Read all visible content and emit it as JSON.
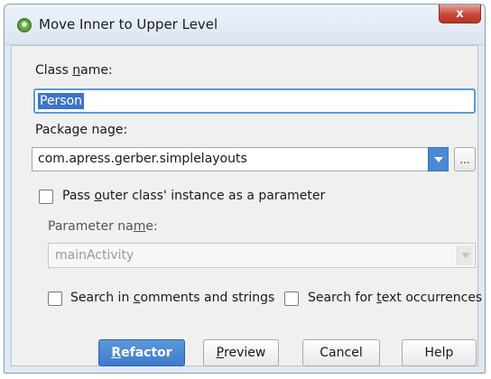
{
  "window": {
    "title": "Move Inner to Upper Level",
    "close_glyph": "x"
  },
  "class_name": {
    "label_pre": "Class ",
    "label_mnemonic": "n",
    "label_post": "ame:",
    "value": "Person"
  },
  "package_name": {
    "label_pre": "Package na",
    "label_mnemonic": "g",
    "label_post": "e:",
    "value": "com.apress.gerber.simplelayouts",
    "browse_label": "..."
  },
  "pass_outer": {
    "label_pre": "Pass ",
    "label_mnemonic": "o",
    "label_post": "uter class' instance as a parameter",
    "checked": false
  },
  "parameter_name": {
    "label_pre": "Parameter na",
    "label_mnemonic": "m",
    "label_post": "e:",
    "value": "mainActivity"
  },
  "search_comments": {
    "label_pre": "Search in ",
    "label_mnemonic": "c",
    "label_post": "omments and strings",
    "checked": false
  },
  "search_text": {
    "label_pre": "Search for ",
    "label_mnemonic": "t",
    "label_post": "ext occurrences",
    "checked": false
  },
  "buttons": {
    "refactor_mnemonic": "R",
    "refactor_rest": "efactor",
    "preview_mnemonic": "P",
    "preview_rest": "review",
    "cancel": "Cancel",
    "help": "Help"
  },
  "colors": {
    "accent": "#3f7ccb",
    "selection": "#3d73c6",
    "close": "#c8493a"
  },
  "icons": {
    "app": "android-icon",
    "close": "close-icon",
    "dropdown": "chevron-down-icon"
  }
}
